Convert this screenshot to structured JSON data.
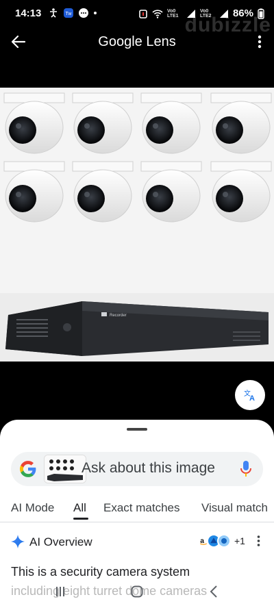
{
  "status_bar": {
    "time": "14:13",
    "carrier1": "Vo0 LTE1",
    "carrier2": "Vo0 LTE2",
    "battery": "86%",
    "watermark": "dubizzle"
  },
  "app_bar": {
    "title": "Google Lens"
  },
  "image": {
    "recorder_label": "Recorder"
  },
  "search": {
    "placeholder": "Ask about this image"
  },
  "tabs": [
    {
      "label": "AI Mode"
    },
    {
      "label": "All"
    },
    {
      "label": "Exact matches"
    },
    {
      "label": "Visual match"
    }
  ],
  "ai_overview": {
    "title": "AI Overview",
    "source_count": "+1",
    "line1": "This is a security camera system",
    "line2": "including eight turret dome cameras"
  },
  "colors": {
    "accent_blue": "#1a73e8",
    "sheet_bg": "#ffffff",
    "search_bg": "#f1f3f4"
  }
}
